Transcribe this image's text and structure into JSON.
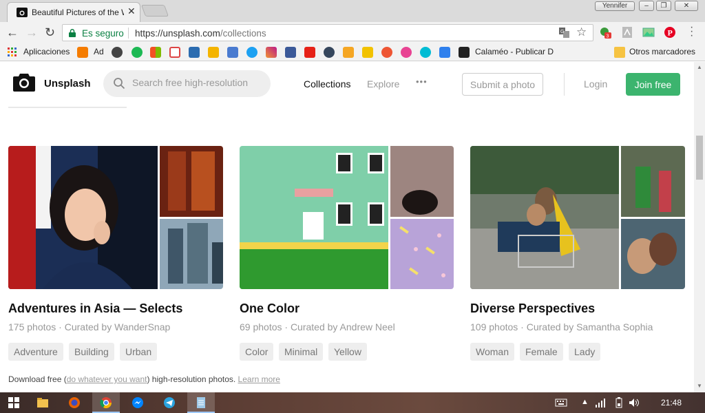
{
  "browser": {
    "tab_title": "Beautiful Pictures of the Worl",
    "tab_close": "✕",
    "user_name": "Yennifer",
    "secure_label": "Es seguro",
    "url_host": "https://unsplash.com",
    "url_path": "/collections",
    "bookmarks": {
      "apps_label": "Aplicaciones",
      "ad_label": "Ad",
      "calameo_label": "Calaméo - Publicar D",
      "other_label": "Otros marcadores"
    },
    "ext_badge": "3"
  },
  "site": {
    "brand": "Unsplash",
    "search_placeholder": "Search free high-resolution",
    "nav_collections": "Collections",
    "nav_explore": "Explore",
    "nav_more": "•••",
    "submit_label": "Submit a photo",
    "login_label": "Login",
    "join_label": "Join free"
  },
  "collections": [
    {
      "title": "Adventures in Asia — Selects",
      "meta": "175 photos · Curated by WanderSnap",
      "tags": [
        "Adventure",
        "Building",
        "Urban"
      ]
    },
    {
      "title": "One Color",
      "meta": "69 photos · Curated by Andrew Neel",
      "tags": [
        "Color",
        "Minimal",
        "Yellow"
      ]
    },
    {
      "title": "Diverse Perspectives",
      "meta": "109 photos · Curated by Samantha Sophia",
      "tags": [
        "Woman",
        "Female",
        "Lady"
      ]
    }
  ],
  "footer": {
    "prefix": "Download free (",
    "link1": "do whatever you want",
    "middle": ") high-resolution photos. ",
    "link2": "Learn more"
  },
  "taskbar": {
    "clock": "21:48"
  }
}
